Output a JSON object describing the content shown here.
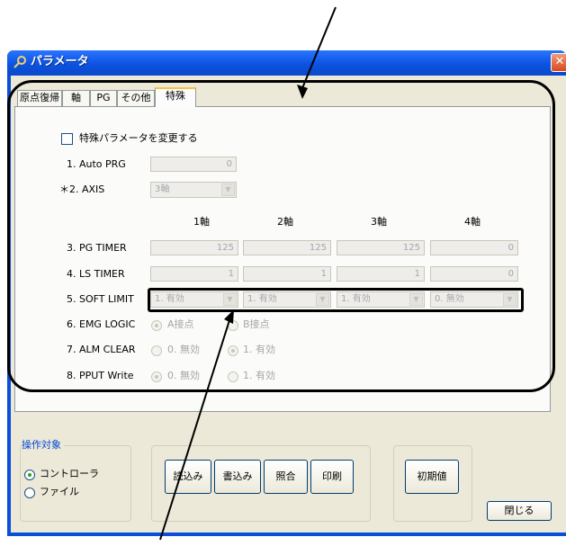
{
  "window": {
    "title": "パラメータ",
    "close_glyph": "✕"
  },
  "tabs": [
    "原点復帰",
    "軸",
    "PG",
    "その他",
    "特殊"
  ],
  "selected_tab": "特殊",
  "special_param": {
    "checkbox_label": "特殊パラメータを変更する",
    "checked": false
  },
  "auto_prg": {
    "label": "1. Auto PRG",
    "value": "0"
  },
  "axis": {
    "label": "＊2. AXIS",
    "value": "3軸"
  },
  "axis_headers": [
    "1軸",
    "2軸",
    "3軸",
    "4軸"
  ],
  "rows": {
    "pg_timer": {
      "label": "3. PG TIMER",
      "values": [
        "125",
        "125",
        "125",
        "0"
      ]
    },
    "ls_timer": {
      "label": "4. LS TIMER",
      "values": [
        "1",
        "1",
        "1",
        "0"
      ]
    },
    "soft_limit": {
      "label": "5. SOFT LIMIT",
      "values": [
        "1. 有効",
        "1. 有効",
        "1. 有効",
        "0. 無効"
      ]
    }
  },
  "emg_logic": {
    "label": "6. EMG LOGIC",
    "options": [
      "A接点",
      "B接点"
    ],
    "selected": "A接点"
  },
  "alm_clear": {
    "label": "7. ALM CLEAR",
    "options": [
      "0. 無効",
      "1. 有効"
    ],
    "selected": "1. 有効"
  },
  "pput_write": {
    "label": "8. PPUT Write",
    "options": [
      "0. 無効",
      "1. 有効"
    ],
    "selected": "0. 無効"
  },
  "target": {
    "title": "操作対象",
    "options": [
      "コントローラ",
      "ファイル"
    ],
    "selected": "コントローラ"
  },
  "buttons": {
    "read": "読込み",
    "write": "書込み",
    "verify": "照合",
    "print": "印刷",
    "defaults": "初期値",
    "close": "閉じる"
  }
}
